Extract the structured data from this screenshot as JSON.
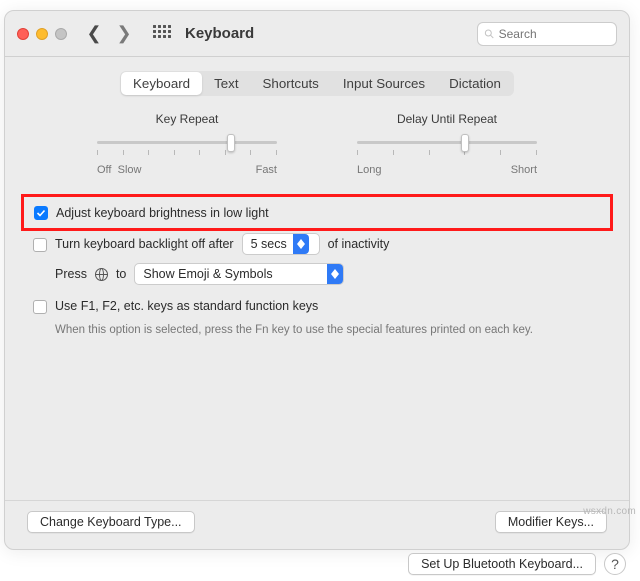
{
  "header": {
    "title": "Keyboard",
    "search_placeholder": "Search"
  },
  "tabs": [
    "Keyboard",
    "Text",
    "Shortcuts",
    "Input Sources",
    "Dictation"
  ],
  "sliders": {
    "key_repeat": {
      "caption": "Key Repeat",
      "left_label": "Off",
      "left2_label": "Slow",
      "right_label": "Fast",
      "ticks": 8,
      "thumb_pos": 0.72
    },
    "delay_repeat": {
      "caption": "Delay Until Repeat",
      "left_label": "Long",
      "right_label": "Short",
      "ticks": 6,
      "thumb_pos": 0.58
    }
  },
  "options": {
    "adjust_brightness": {
      "checked": true,
      "label": "Adjust keyboard brightness in low light"
    },
    "backlight_off": {
      "checked": false,
      "label_pre": "Turn keyboard backlight off after",
      "popup_value": "5 secs",
      "label_post": "of inactivity"
    },
    "press_fn": {
      "label_pre": "Press",
      "label_mid": "to",
      "popup_value": "Show Emoji & Symbols"
    },
    "function_keys": {
      "checked": false,
      "label": "Use F1, F2, etc. keys as standard function keys",
      "help": "When this option is selected, press the Fn key to use the special features printed on each key."
    }
  },
  "buttons": {
    "change_type": "Change Keyboard Type...",
    "modifier_keys": "Modifier Keys..."
  },
  "footer": {
    "bluetooth": "Set Up Bluetooth Keyboard...",
    "help": "?"
  },
  "watermark": "wsxdn.com"
}
